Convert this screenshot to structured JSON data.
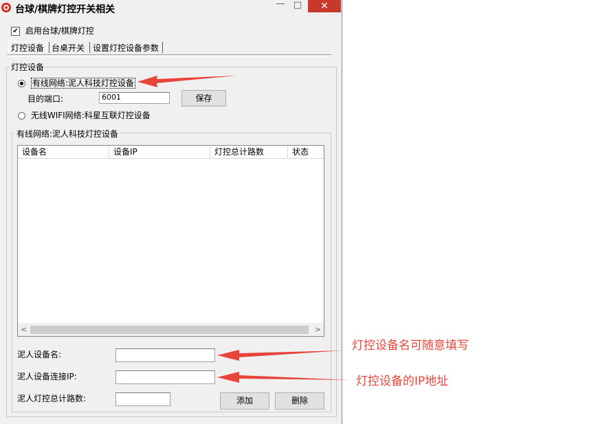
{
  "window": {
    "title": "台球/棋牌灯控开关相关",
    "controls": {
      "minimize": "—",
      "maximize": "□",
      "close": "✕"
    }
  },
  "enable_checkbox": {
    "label": "启用台球/棋牌灯控",
    "checked": true,
    "mark": "✔"
  },
  "tabs": [
    {
      "label": "灯控设备",
      "selected": true
    },
    {
      "label": "台桌开关",
      "selected": false
    },
    {
      "label": "设置灯控设备参数",
      "selected": false
    }
  ],
  "device_group": {
    "title": "灯控设备",
    "wired_option": {
      "label": "有线网络:泥人科技灯控设备",
      "selected": true
    },
    "port": {
      "label": "目的端口:",
      "value": "6001"
    },
    "save_button": "保存",
    "wifi_option": {
      "label": "无线WIFI网络:科星互联灯控设备",
      "selected": false
    }
  },
  "wired_group": {
    "title": "有线网络:泥人科技灯控设备",
    "columns": [
      "设备名",
      "设备IP",
      "灯控总计路数",
      "状态"
    ],
    "rows": [],
    "scroll_left": "<",
    "scroll_right": ">",
    "device_name": {
      "label": "泥人设备名:",
      "value": ""
    },
    "device_ip": {
      "label": "泥人设备连接IP:",
      "value": ""
    },
    "light_count": {
      "label": "泥人灯控总计路数:",
      "value": ""
    },
    "add_button": "添加",
    "delete_button": "删除"
  },
  "annotations": {
    "name_note": "灯控设备名可随意填写",
    "ip_note": "灯控设备的IP地址",
    "color": "#e8443a"
  }
}
